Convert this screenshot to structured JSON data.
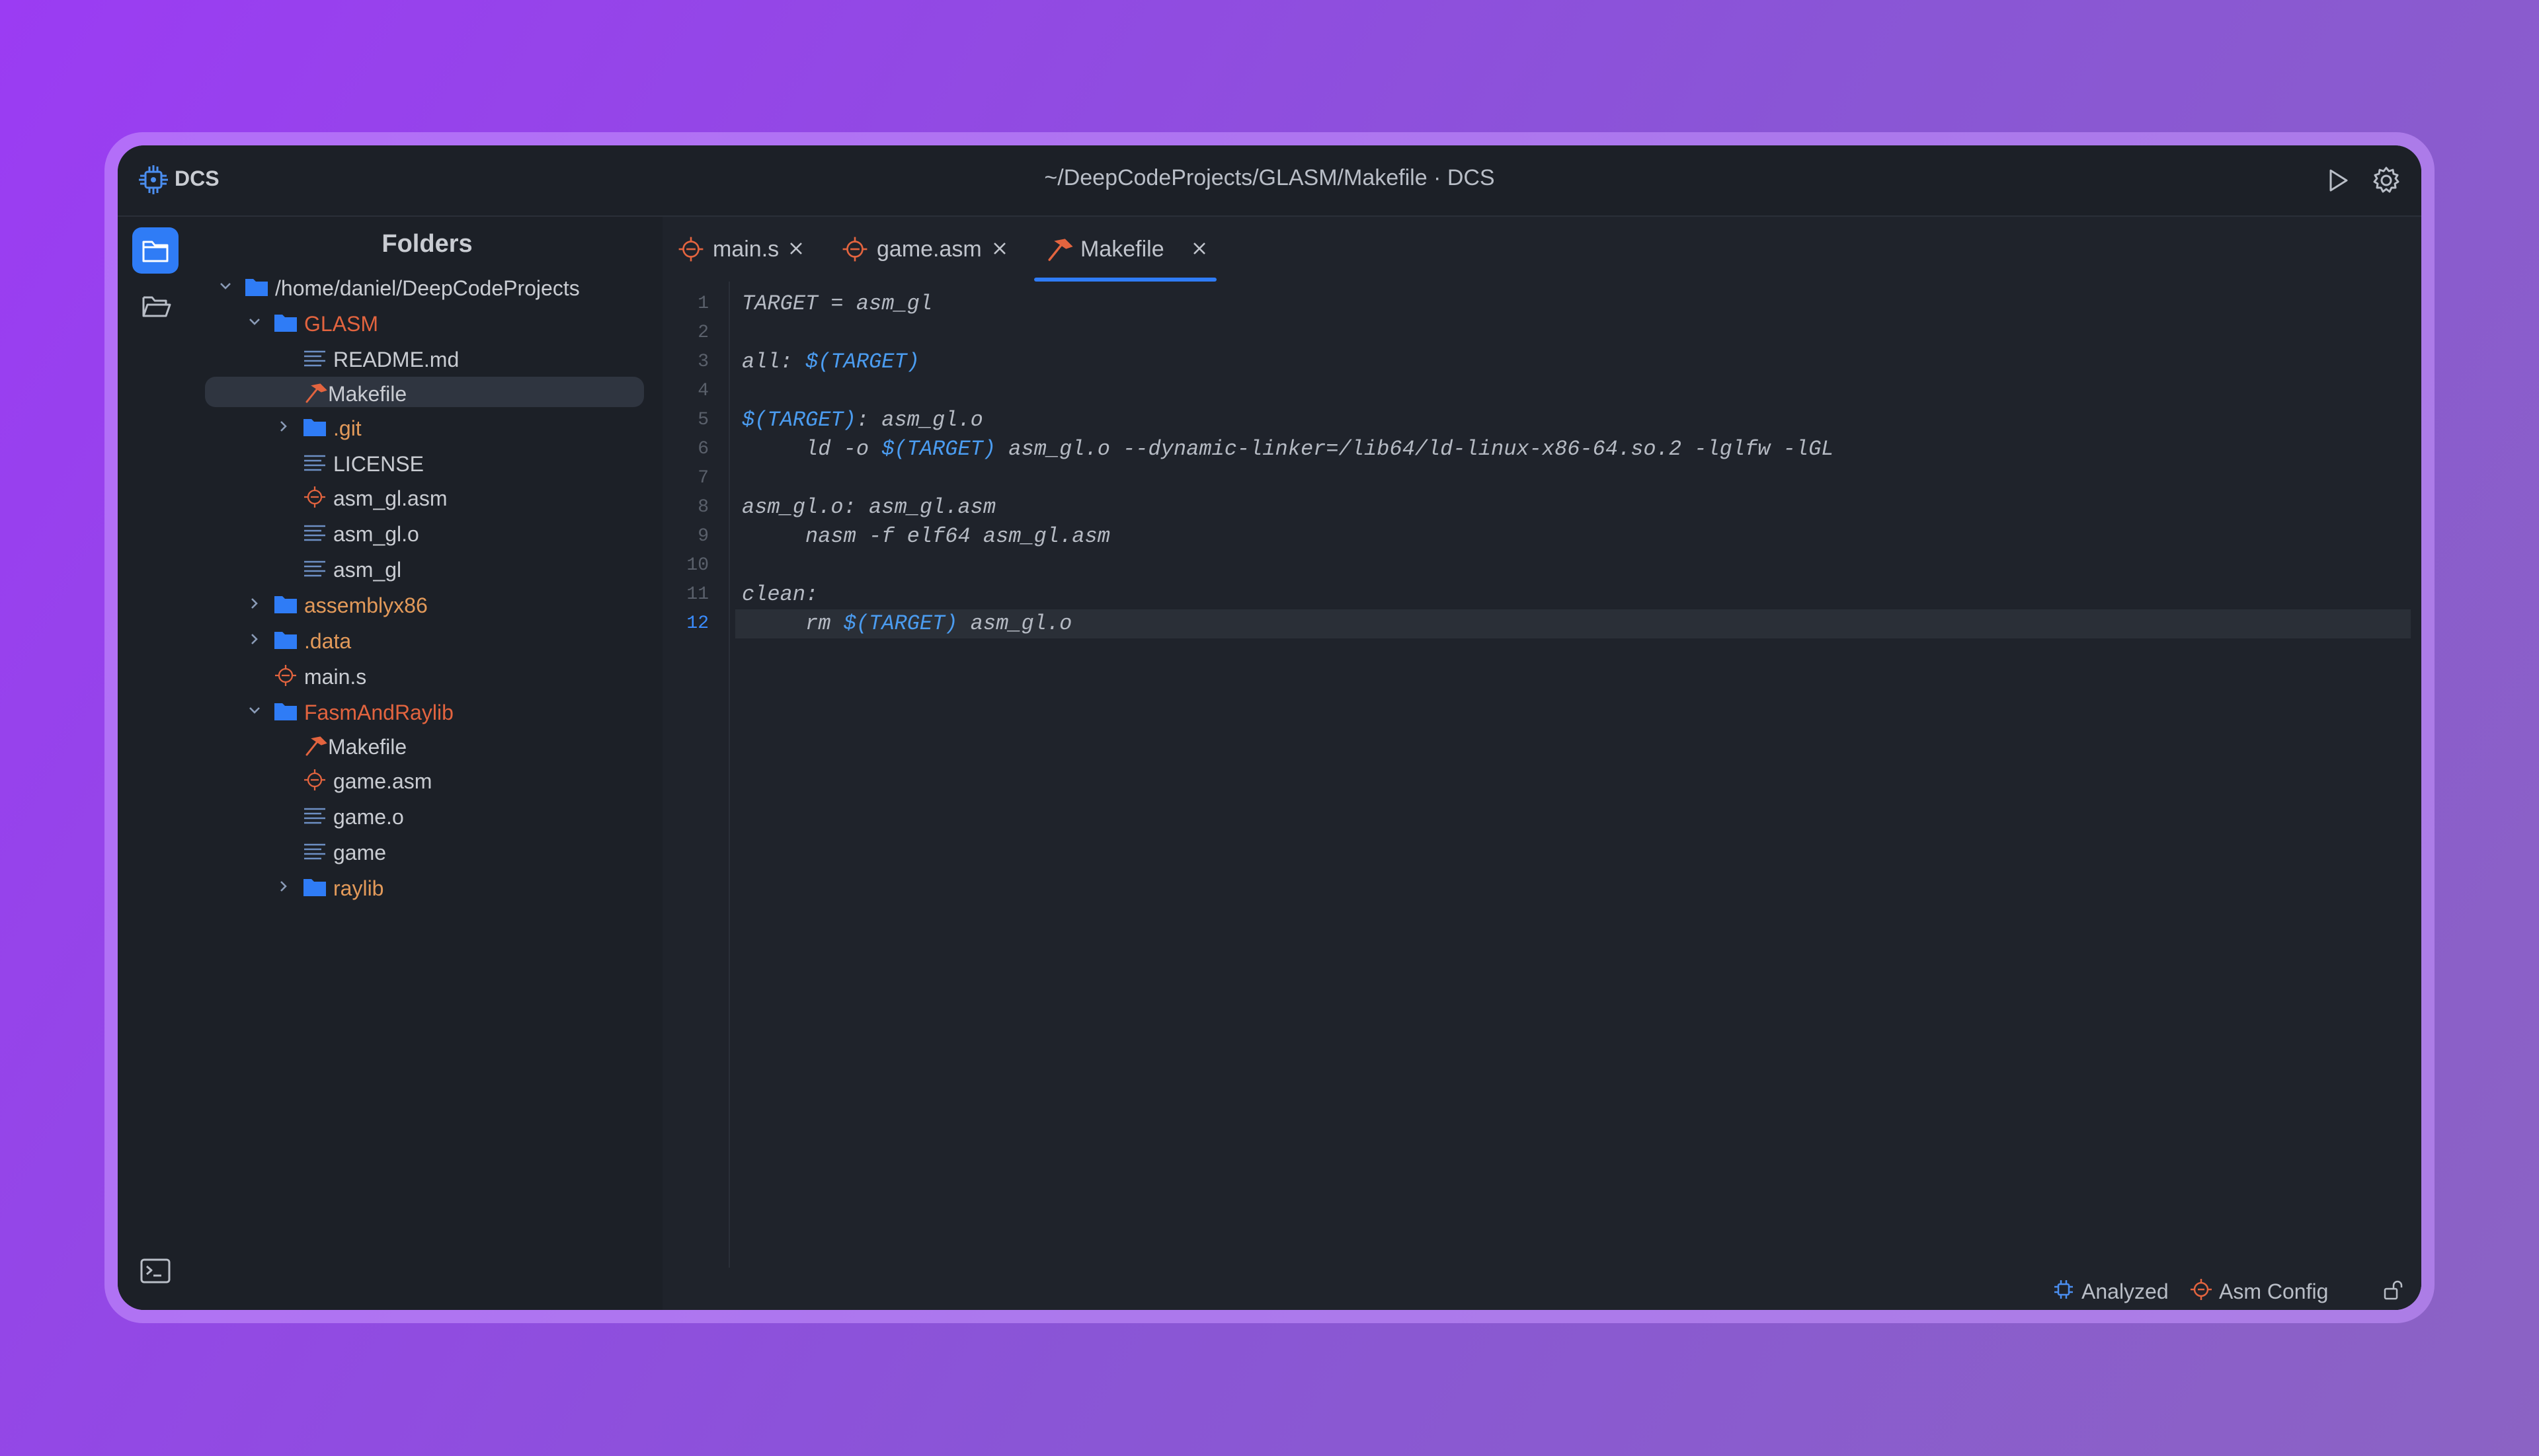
{
  "app": {
    "name": "DCS",
    "window_title": "~/DeepCodeProjects/GLASM/Makefile · DCS"
  },
  "titlebar": {
    "run_icon": "play-icon",
    "settings_icon": "gear-icon"
  },
  "activity_bar": {
    "items": [
      "folder-icon",
      "open-folder-icon",
      "terminal-icon"
    ]
  },
  "sidebar": {
    "title": "Folders",
    "tree": [
      {
        "label": "/home/daniel/DeepCodeProjects",
        "type": "folder",
        "expanded": true,
        "depth": 0
      },
      {
        "label": "GLASM",
        "type": "folder",
        "expanded": true,
        "depth": 1
      },
      {
        "label": "README.md",
        "type": "text",
        "depth": 2
      },
      {
        "label": "Makefile",
        "type": "make",
        "depth": 2,
        "selected": true
      },
      {
        "label": ".git",
        "type": "folder",
        "expanded": false,
        "depth": 2
      },
      {
        "label": "LICENSE",
        "type": "text",
        "depth": 2
      },
      {
        "label": "asm_gl.asm",
        "type": "asm",
        "depth": 2
      },
      {
        "label": "asm_gl.o",
        "type": "text",
        "depth": 2
      },
      {
        "label": "asm_gl",
        "type": "text",
        "depth": 2
      },
      {
        "label": "assemblyx86",
        "type": "folder",
        "expanded": false,
        "depth": 1
      },
      {
        "label": ".data",
        "type": "folder",
        "expanded": false,
        "depth": 1
      },
      {
        "label": "main.s",
        "type": "asm",
        "depth": 1
      },
      {
        "label": "FasmAndRaylib",
        "type": "folder",
        "expanded": true,
        "depth": 1
      },
      {
        "label": "Makefile",
        "type": "make",
        "depth": 2
      },
      {
        "label": "game.asm",
        "type": "asm",
        "depth": 2
      },
      {
        "label": "game.o",
        "type": "text",
        "depth": 2
      },
      {
        "label": "game",
        "type": "text",
        "depth": 2
      },
      {
        "label": "raylib",
        "type": "folder",
        "expanded": false,
        "depth": 2
      }
    ]
  },
  "tabs": [
    {
      "label": "main.s",
      "icon": "asm-chip-icon",
      "active": false
    },
    {
      "label": "game.asm",
      "icon": "asm-chip-icon",
      "active": false
    },
    {
      "label": "Makefile",
      "icon": "hammer-icon",
      "active": true
    }
  ],
  "editor": {
    "current_line": 12,
    "lines": [
      "TARGET = asm_gl",
      "",
      "all: $(TARGET)",
      "",
      "$(TARGET): asm_gl.o",
      "     ld -o $(TARGET) asm_gl.o --dynamic-linker=/lib64/ld-linux-x86-64.so.2 -lglfw -lGL",
      "",
      "asm_gl.o: asm_gl.asm",
      "     nasm -f elf64 asm_gl.asm",
      "",
      "clean:",
      "     rm $(TARGET) asm_gl.o"
    ]
  },
  "statusbar": {
    "analyzed": "Analyzed",
    "config": "Asm Config",
    "lock_icon": "unlock-icon"
  },
  "colors": {
    "accent_blue": "#2f7cf6",
    "folder_blue": "#2f7cf6",
    "accent_orange": "#e3643f",
    "background": "#1b1f26"
  }
}
